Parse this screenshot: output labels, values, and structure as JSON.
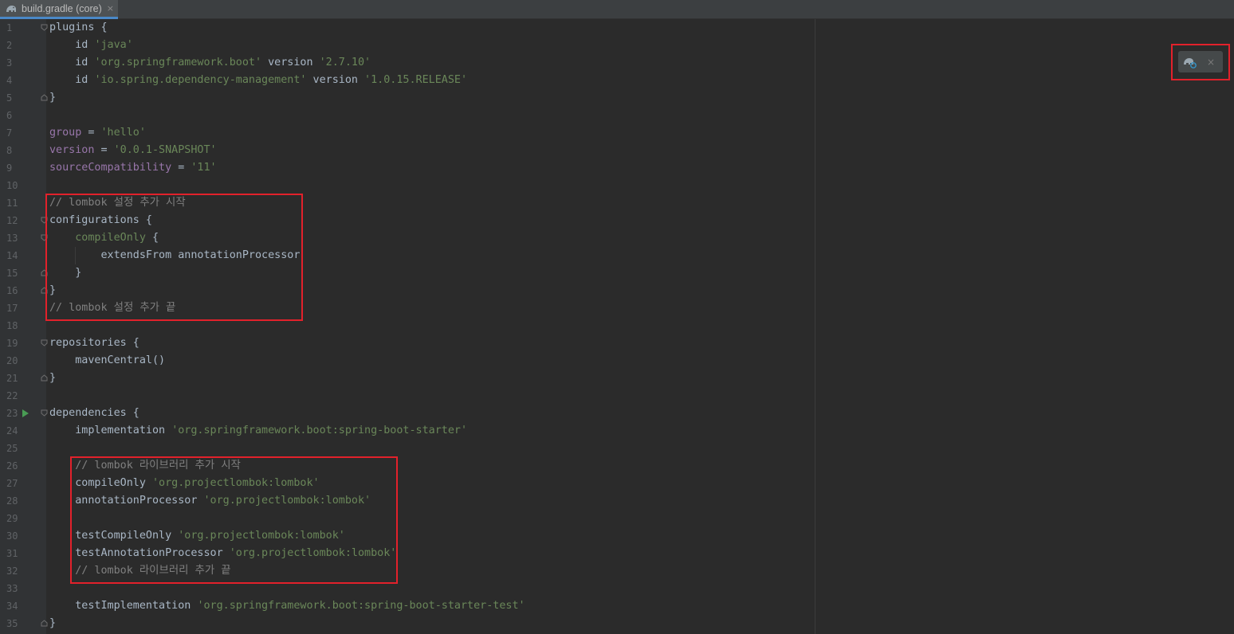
{
  "tab": {
    "label": "build.gradle (core)",
    "close": "×"
  },
  "gradle_widget": {
    "close": "×",
    "icon": "gradle-reload-icon"
  },
  "line_numbers": [
    "1",
    "2",
    "3",
    "4",
    "5",
    "6",
    "7",
    "8",
    "9",
    "10",
    "11",
    "12",
    "13",
    "14",
    "15",
    "16",
    "17",
    "18",
    "19",
    "20",
    "21",
    "22",
    "23",
    "24",
    "25",
    "26",
    "27",
    "28",
    "29",
    "30",
    "31",
    "32",
    "33",
    "34",
    "35"
  ],
  "code": {
    "l1": "plugins {",
    "l2a": "    id ",
    "l2b": "'java'",
    "l3a": "    id ",
    "l3b": "'org.springframework.boot'",
    "l3c": " version ",
    "l3d": "'2.7.10'",
    "l4a": "    id ",
    "l4b": "'io.spring.dependency-management'",
    "l4c": " version ",
    "l4d": "'1.0.15.RELEASE'",
    "l5": "}",
    "l7a": "group",
    "l7b": " = ",
    "l7c": "'hello'",
    "l8a": "version",
    "l8b": " = ",
    "l8c": "'0.0.1-SNAPSHOT'",
    "l9a": "sourceCompatibility",
    "l9b": " = ",
    "l9c": "'11'",
    "l11": "// lombok 설정 추가 시작",
    "l12": "configurations {",
    "l13a": "    ",
    "l13b": "compileOnly",
    "l13c": " {",
    "l14": "        extendsFrom annotationProcessor",
    "l15": "    }",
    "l16": "}",
    "l17": "// lombok 설정 추가 끝",
    "l19": "repositories {",
    "l20": "    mavenCentral()",
    "l21": "}",
    "l23": "dependencies {",
    "l24a": "    implementation ",
    "l24b": "'org.springframework.boot:spring-boot-starter'",
    "l26": "    // lombok 라이브러리 추가 시작",
    "l27a": "    compileOnly ",
    "l27b": "'org.projectlombok:lombok'",
    "l28a": "    annotationProcessor ",
    "l28b": "'org.projectlombok:lombok'",
    "l30a": "    testCompileOnly ",
    "l30b": "'org.projectlombok:lombok'",
    "l31a": "    testAnnotationProcessor ",
    "l31b": "'org.projectlombok:lombok'",
    "l32": "    // lombok 라이브러리 추가 끝",
    "l34a": "    testImplementation ",
    "l34b": "'org.springframework.boot:spring-boot-starter-test'",
    "l35": "}"
  },
  "colors": {
    "highlight_box": "#e2212b",
    "string": "#6a8759",
    "property": "#9876aa",
    "comment": "#808080"
  }
}
